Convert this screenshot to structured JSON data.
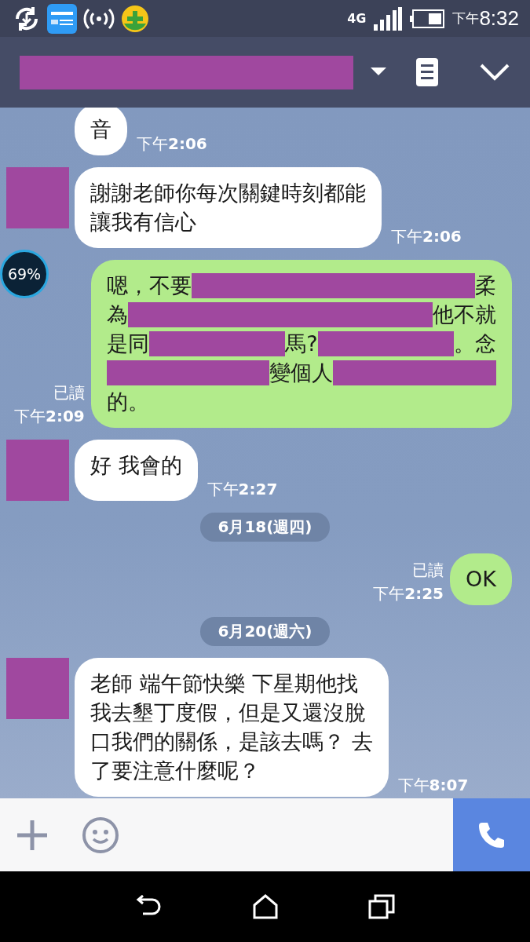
{
  "status_bar": {
    "network": "4G",
    "time_prefix": "下午",
    "time": "8:32"
  },
  "header": {
    "title": {
      "kind": "redaction"
    }
  },
  "floating_widget": {
    "label": "69%"
  },
  "messages": [
    {
      "kind": "received",
      "lines": [
        "音"
      ],
      "time": "下午**2:06**"
    },
    {
      "kind": "received",
      "avatar": {
        "kind": "redaction"
      },
      "lines": [
        "謝謝老師你每次關鍵時刻都能",
        "讓我有信心"
      ],
      "time": "下午**2:06**"
    },
    {
      "kind": "sent",
      "read": "已讀",
      "time": "下午**2:09**",
      "lines": [
        [
          {
            "text": "嗯，不要"
          },
          {
            "kind": "redaction"
          },
          {
            "text": "柔"
          }
        ],
        [
          {
            "text": "為"
          },
          {
            "kind": "redaction"
          },
          {
            "text": "他不就"
          }
        ],
        [
          {
            "text": "是同"
          },
          {
            "kind": "redaction"
          },
          {
            "text": "馬?"
          },
          {
            "kind": "redaction"
          },
          {
            "text": "。念"
          }
        ],
        [
          {
            "kind": "redaction"
          },
          {
            "text": "變個人"
          },
          {
            "kind": "redaction"
          }
        ],
        "的。"
      ]
    },
    {
      "kind": "received",
      "avatar": {
        "kind": "redaction"
      },
      "lines": [
        "好 我會的"
      ],
      "time": "下午**2:27**"
    },
    {
      "kind": "date",
      "label": "6月18(週四)"
    },
    {
      "kind": "sent",
      "read": "已讀",
      "time": "下午**2:25**",
      "lines": [
        "OK"
      ]
    },
    {
      "kind": "date",
      "label": "6月20(週六)"
    },
    {
      "kind": "received",
      "avatar": {
        "kind": "redaction"
      },
      "lines": [
        "老師 端午節快樂 下星期他找",
        "我去墾丁度假，但是又還沒脫",
        "口我們的關係，是該去嗎？ 去",
        "了要注意什麼呢？"
      ],
      "time": "下午**8:07**"
    }
  ]
}
